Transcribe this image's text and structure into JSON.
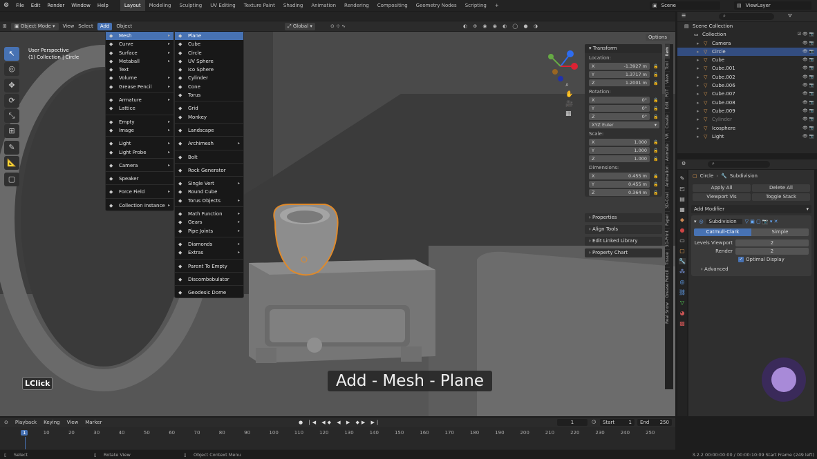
{
  "topbar": {
    "menus": [
      "File",
      "Edit",
      "Render",
      "Window",
      "Help"
    ],
    "workspaces": [
      "Layout",
      "Modeling",
      "Sculpting",
      "UV Editing",
      "Texture Paint",
      "Shading",
      "Animation",
      "Rendering",
      "Compositing",
      "Geometry Nodes",
      "Scripting"
    ],
    "active_workspace": "Layout",
    "add_workspace": "+",
    "scene": "Scene",
    "view_layer": "ViewLayer"
  },
  "vp_header": {
    "mode": "Object Mode",
    "view": "View",
    "select": "Select",
    "add": "Add",
    "object": "Object",
    "orientation": "Global",
    "options": "Options"
  },
  "viewport": {
    "perspective": "User Perspective",
    "collection": "(1) Collection | Circle",
    "caption": "Add - Mesh - Plane",
    "key_hint": "LClick"
  },
  "add_menu": [
    {
      "label": "Mesh",
      "icon": "mesh-icon",
      "sub": true,
      "hl": true
    },
    {
      "label": "Curve",
      "sub": true
    },
    {
      "label": "Surface",
      "sub": true
    },
    {
      "label": "Metaball",
      "sub": true
    },
    {
      "label": "Text"
    },
    {
      "label": "Volume",
      "sub": true
    },
    {
      "label": "Grease Pencil",
      "sub": true,
      "sep_after": true
    },
    {
      "label": "Armature",
      "sub": true
    },
    {
      "label": "Lattice",
      "sep_after": true
    },
    {
      "label": "Empty",
      "sub": true
    },
    {
      "label": "Image",
      "sub": true,
      "sep_after": true
    },
    {
      "label": "Light",
      "sub": true
    },
    {
      "label": "Light Probe",
      "sub": true,
      "sep_after": true
    },
    {
      "label": "Camera",
      "sub": true,
      "sep_after": true
    },
    {
      "label": "Speaker",
      "sep_after": true
    },
    {
      "label": "Force Field",
      "sub": true,
      "sep_after": true
    },
    {
      "label": "Collection Instance",
      "sub": true
    }
  ],
  "mesh_menu": [
    {
      "label": "Plane",
      "hl": true
    },
    {
      "label": "Cube"
    },
    {
      "label": "Circle"
    },
    {
      "label": "UV Sphere"
    },
    {
      "label": "Ico Sphere"
    },
    {
      "label": "Cylinder"
    },
    {
      "label": "Cone"
    },
    {
      "label": "Torus",
      "sep_after": true
    },
    {
      "label": "Grid"
    },
    {
      "label": "Monkey",
      "sep_after": true
    },
    {
      "label": "Landscape",
      "sep_after": true
    },
    {
      "label": "Archimesh",
      "sub": true,
      "sep_after": true
    },
    {
      "label": "Bolt",
      "sep_after": true
    },
    {
      "label": "Rock Generator",
      "sep_after": true
    },
    {
      "label": "Single Vert",
      "sub": true
    },
    {
      "label": "Round Cube"
    },
    {
      "label": "Torus Objects",
      "sub": true,
      "sep_after": true
    },
    {
      "label": "Math Function",
      "sub": true
    },
    {
      "label": "Gears",
      "sub": true
    },
    {
      "label": "Pipe Joints",
      "sub": true,
      "sep_after": true
    },
    {
      "label": "Diamonds",
      "sub": true
    },
    {
      "label": "Extras",
      "sub": true,
      "sep_after": true
    },
    {
      "label": "Parent To Empty",
      "sep_after": true
    },
    {
      "label": "Discombobulator",
      "sep_after": true
    },
    {
      "label": "Geodesic Dome"
    }
  ],
  "npanel": {
    "title": "Transform",
    "location_label": "Location:",
    "location": [
      {
        "axis": "X",
        "value": "-1.3927 m"
      },
      {
        "axis": "Y",
        "value": "1.3717 m"
      },
      {
        "axis": "Z",
        "value": "1.2001 m"
      }
    ],
    "rotation_label": "Rotation:",
    "rotation": [
      {
        "axis": "X",
        "value": "0°"
      },
      {
        "axis": "Y",
        "value": "0°"
      },
      {
        "axis": "Z",
        "value": "0°"
      }
    ],
    "rotation_mode": "XYZ Euler",
    "scale_label": "Scale:",
    "scale": [
      {
        "axis": "X",
        "value": "1.000"
      },
      {
        "axis": "Y",
        "value": "1.000"
      },
      {
        "axis": "Z",
        "value": "1.000"
      }
    ],
    "dimensions_label": "Dimensions:",
    "dimensions": [
      {
        "axis": "X",
        "value": "0.455 m"
      },
      {
        "axis": "Y",
        "value": "0.455 m"
      },
      {
        "axis": "Z",
        "value": "0.364 m"
      }
    ],
    "panels": [
      "Properties",
      "Align Tools",
      "Edit Linked Library",
      "Property Chart"
    ]
  },
  "side_tabs": [
    "Item",
    "Tool",
    "View",
    "PDT",
    "Edit",
    "Create",
    "VR",
    "Animate",
    "Animation",
    "3D-Coat",
    "Paper",
    "3D-Print",
    "Tissue",
    "Grease Pencil",
    "Real Snow"
  ],
  "outliner": {
    "scene_collection": "Scene Collection",
    "collection": "Collection",
    "items": [
      {
        "label": "Camera"
      },
      {
        "label": "Circle",
        "sel": true
      },
      {
        "label": "Cube"
      },
      {
        "label": "Cube.001"
      },
      {
        "label": "Cube.002"
      },
      {
        "label": "Cube.006"
      },
      {
        "label": "Cube.007"
      },
      {
        "label": "Cube.008"
      },
      {
        "label": "Cube.009"
      },
      {
        "label": "Cylinder",
        "dim": true
      },
      {
        "label": "Icosphere"
      },
      {
        "label": "Light"
      }
    ]
  },
  "properties": {
    "object": "Circle",
    "modifier_name": "Subdivision",
    "apply_all": "Apply All",
    "delete_all": "Delete All",
    "viewport_vis": "Viewport Vis",
    "toggle_stack": "Toggle Stack",
    "add_modifier": "Add Modifier",
    "catmull": "Catmull-Clark",
    "simple": "Simple",
    "levels_label": "Levels Viewport",
    "levels_value": "2",
    "render_label": "Render",
    "render_value": "2",
    "optimal": "Optimal Display",
    "advanced": "Advanced"
  },
  "timeline": {
    "playback": "Playback",
    "keying": "Keying",
    "view": "View",
    "marker": "Marker",
    "current_frame": "1",
    "start_label": "Start",
    "start": "1",
    "end_label": "End",
    "end": "250",
    "ticks": [
      "1",
      "10",
      "20",
      "30",
      "40",
      "50",
      "60",
      "70",
      "80",
      "90",
      "100",
      "110",
      "120",
      "130",
      "140",
      "150",
      "160",
      "170",
      "180",
      "190",
      "200",
      "210",
      "220",
      "230",
      "240",
      "250"
    ]
  },
  "status": {
    "select": "Select",
    "rotate": "Rotate View",
    "context": "Object Context Menu",
    "info": "3.2.2 00:00:00:00 / 00:00:10:09 Start Frame (249 left)"
  }
}
